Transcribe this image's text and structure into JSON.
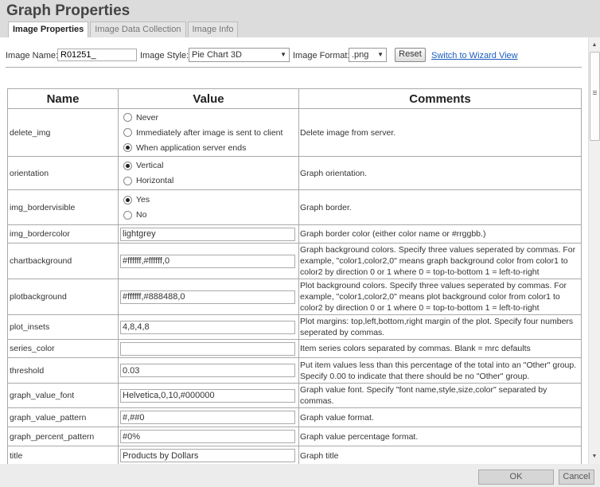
{
  "window": {
    "title": "Graph Properties"
  },
  "tabs": [
    {
      "label": "Image Properties"
    },
    {
      "label": "Image Data Collection"
    },
    {
      "label": "Image Info"
    }
  ],
  "toolbar": {
    "image_name_label": "Image Name:",
    "image_name_value": "R01251_",
    "image_style_label": "Image Style:",
    "image_style_value": "Pie Chart 3D",
    "image_format_label": "Image Format:",
    "image_format_value": ".png",
    "reset_label": "Reset",
    "wizard_link": "Switch to Wizard View"
  },
  "table": {
    "headers": {
      "name": "Name",
      "value": "Value",
      "comments": "Comments"
    },
    "rows": [
      {
        "name": "delete_img",
        "radios": [
          {
            "label": "Never",
            "checked": false
          },
          {
            "label": "Immediately after image is sent to client",
            "checked": false
          },
          {
            "label": "When application server ends",
            "checked": true
          }
        ],
        "comment": "Delete image from server."
      },
      {
        "name": "orientation",
        "radios": [
          {
            "label": "Vertical",
            "checked": true
          },
          {
            "label": "Horizontal",
            "checked": false
          }
        ],
        "comment": "Graph orientation."
      },
      {
        "name": "img_bordervisible",
        "radios": [
          {
            "label": "Yes",
            "checked": true
          },
          {
            "label": "No",
            "checked": false
          }
        ],
        "comment": "Graph border."
      },
      {
        "name": "img_bordercolor",
        "value": "lightgrey",
        "comment": "Graph border color (either color name or #rrggbb.)"
      },
      {
        "name": "chartbackground",
        "value": "#ffffff,#ffffff,0",
        "comment": "Graph background colors. Specify three values seperated by commas. For example, \"color1,color2,0\" means graph background color from color1 to color2 by direction 0 or 1 where 0 = top-to-bottom 1 = left-to-right"
      },
      {
        "name": "plotbackground",
        "value": "#ffffff,#888488,0",
        "comment": "Plot background colors. Specify three values seperated by commas. For example, \"color1,color2,0\" means plot background color from color1 to color2 by direction 0 or 1 where 0 = top-to-bottom 1 = left-to-right"
      },
      {
        "name": "plot_insets",
        "value": "4,8,4,8",
        "comment": "Plot margins: top,left,bottom,right margin of the plot. Specify four numbers seperated by commas."
      },
      {
        "name": "series_color",
        "value": "",
        "comment": "Item series colors separated by commas. Blank = mrc defaults"
      },
      {
        "name": "threshold",
        "value": "0.03",
        "comment": "Put item values less than this percentage of the total into an \"Other\" group. Specify 0.00 to indicate that there should be no \"Other\" group."
      },
      {
        "name": "graph_value_font",
        "value": "Helvetica,0,10,#000000",
        "comment": "Graph value font. Specify \"font name,style,size,color\" separated by commas."
      },
      {
        "name": "graph_value_pattern",
        "value": "#,##0",
        "comment": "Graph value format."
      },
      {
        "name": "graph_percent_pattern",
        "value": "#0%",
        "comment": "Graph value percentage format."
      },
      {
        "name": "title",
        "value": "Products by Dollars",
        "comment": "Graph title"
      }
    ]
  },
  "footer": {
    "ok_label": "OK",
    "cancel_label": "Cancel"
  }
}
